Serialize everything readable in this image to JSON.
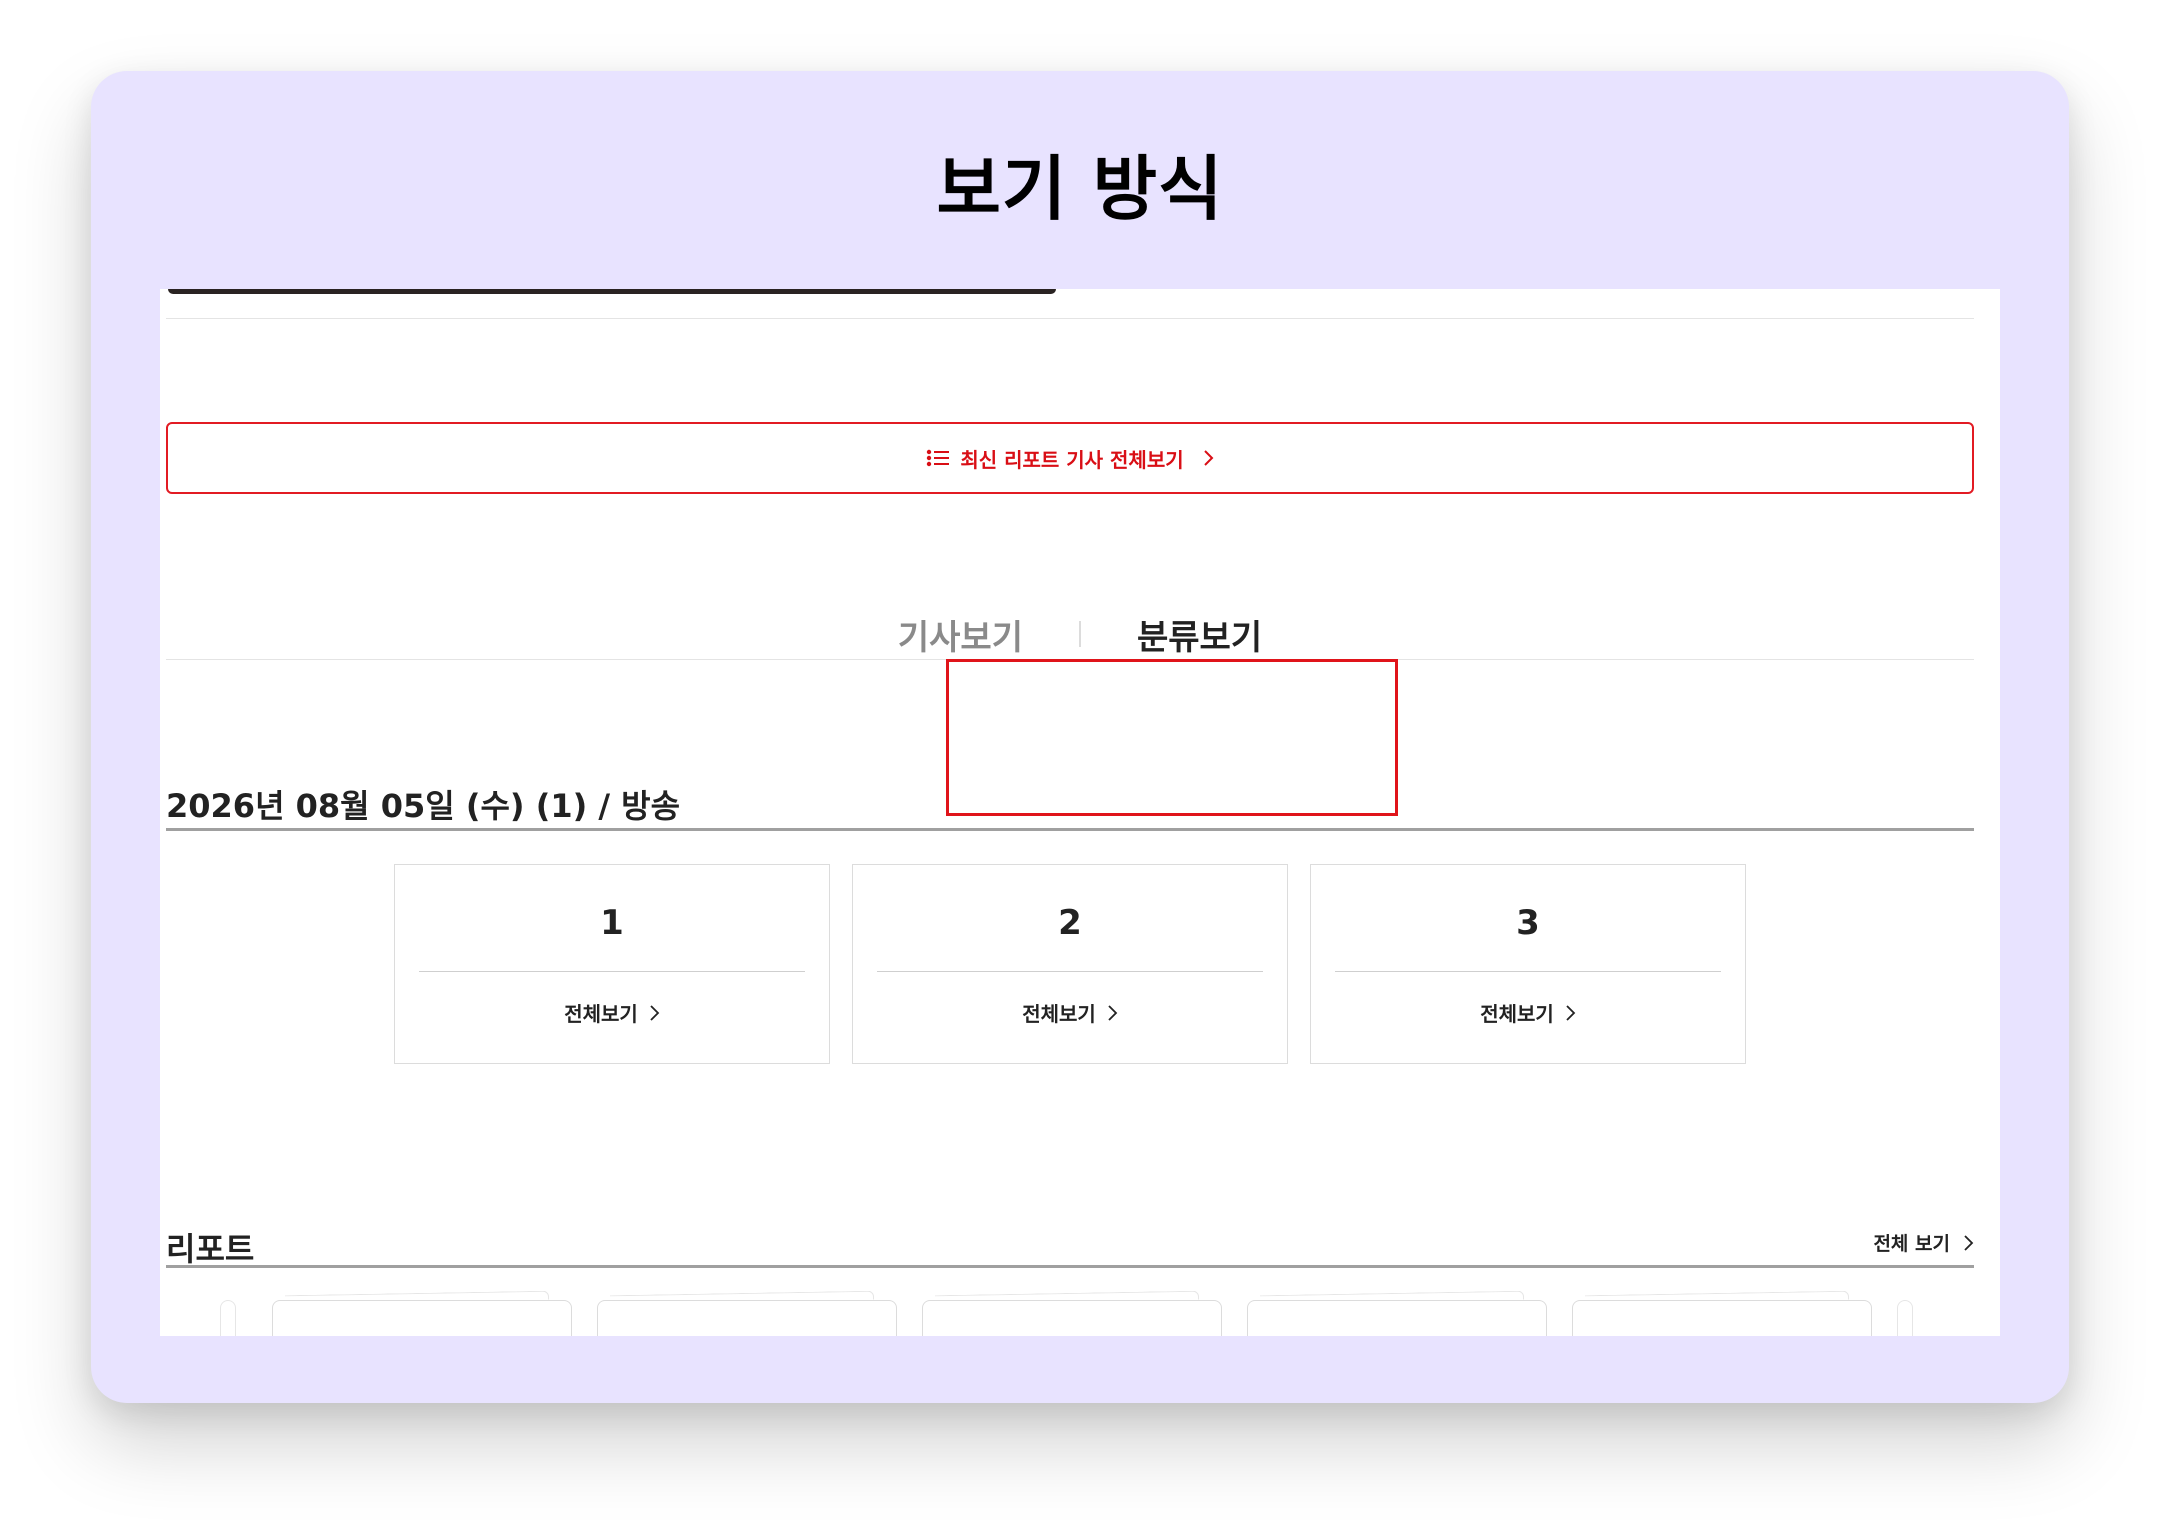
{
  "frame": {
    "title": "보기 방식"
  },
  "report_all_button": {
    "label": "최신 리포트 기사 전체보기",
    "icon": "list-icon"
  },
  "view_tabs": [
    {
      "label": "기사보기",
      "active": false
    },
    {
      "label": "분류보기",
      "active": true
    }
  ],
  "date_heading": "2026년 08월 05일 (수) (1) / 방송",
  "categories": [
    {
      "number": "1",
      "link": "전체보기"
    },
    {
      "number": "2",
      "link": "전체보기"
    },
    {
      "number": "3",
      "link": "전체보기"
    }
  ],
  "report_section": {
    "title": "리포트",
    "view_all": "전체 보기"
  },
  "colors": {
    "frame_bg": "#e8e3ff",
    "accent_red": "#e21b23",
    "text": "#222222"
  }
}
